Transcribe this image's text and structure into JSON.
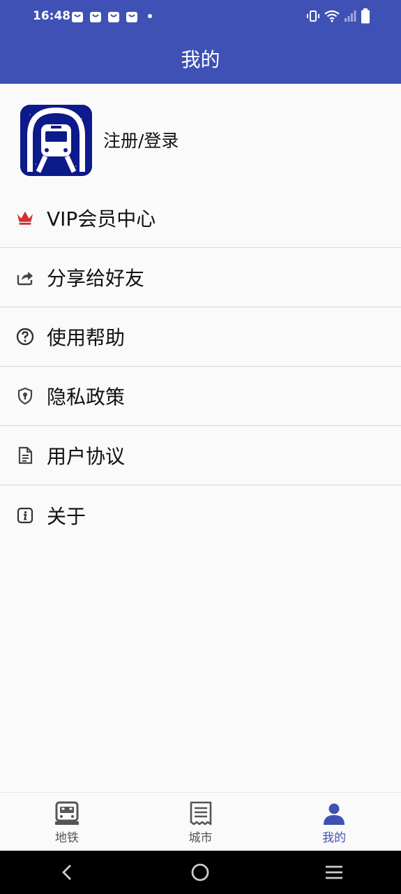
{
  "status_bar": {
    "time": "16:48"
  },
  "app_bar": {
    "title": "我的"
  },
  "profile": {
    "login_text": "注册/登录"
  },
  "menu": [
    {
      "label": "VIP会员中心",
      "icon": "crown-icon"
    },
    {
      "label": "分享给好友",
      "icon": "share-icon"
    },
    {
      "label": "使用帮助",
      "icon": "help-icon"
    },
    {
      "label": "隐私政策",
      "icon": "shield-icon"
    },
    {
      "label": "用户协议",
      "icon": "document-icon"
    },
    {
      "label": "关于",
      "icon": "info-icon"
    }
  ],
  "bottom_nav": [
    {
      "label": "地铁",
      "icon": "train-icon",
      "active": false
    },
    {
      "label": "城市",
      "icon": "receipt-icon",
      "active": false
    },
    {
      "label": "我的",
      "icon": "person-icon",
      "active": true
    }
  ],
  "colors": {
    "primary": "#3f51b5",
    "logo_bg": "#0d1a8a",
    "crown": "#d32f2f"
  }
}
